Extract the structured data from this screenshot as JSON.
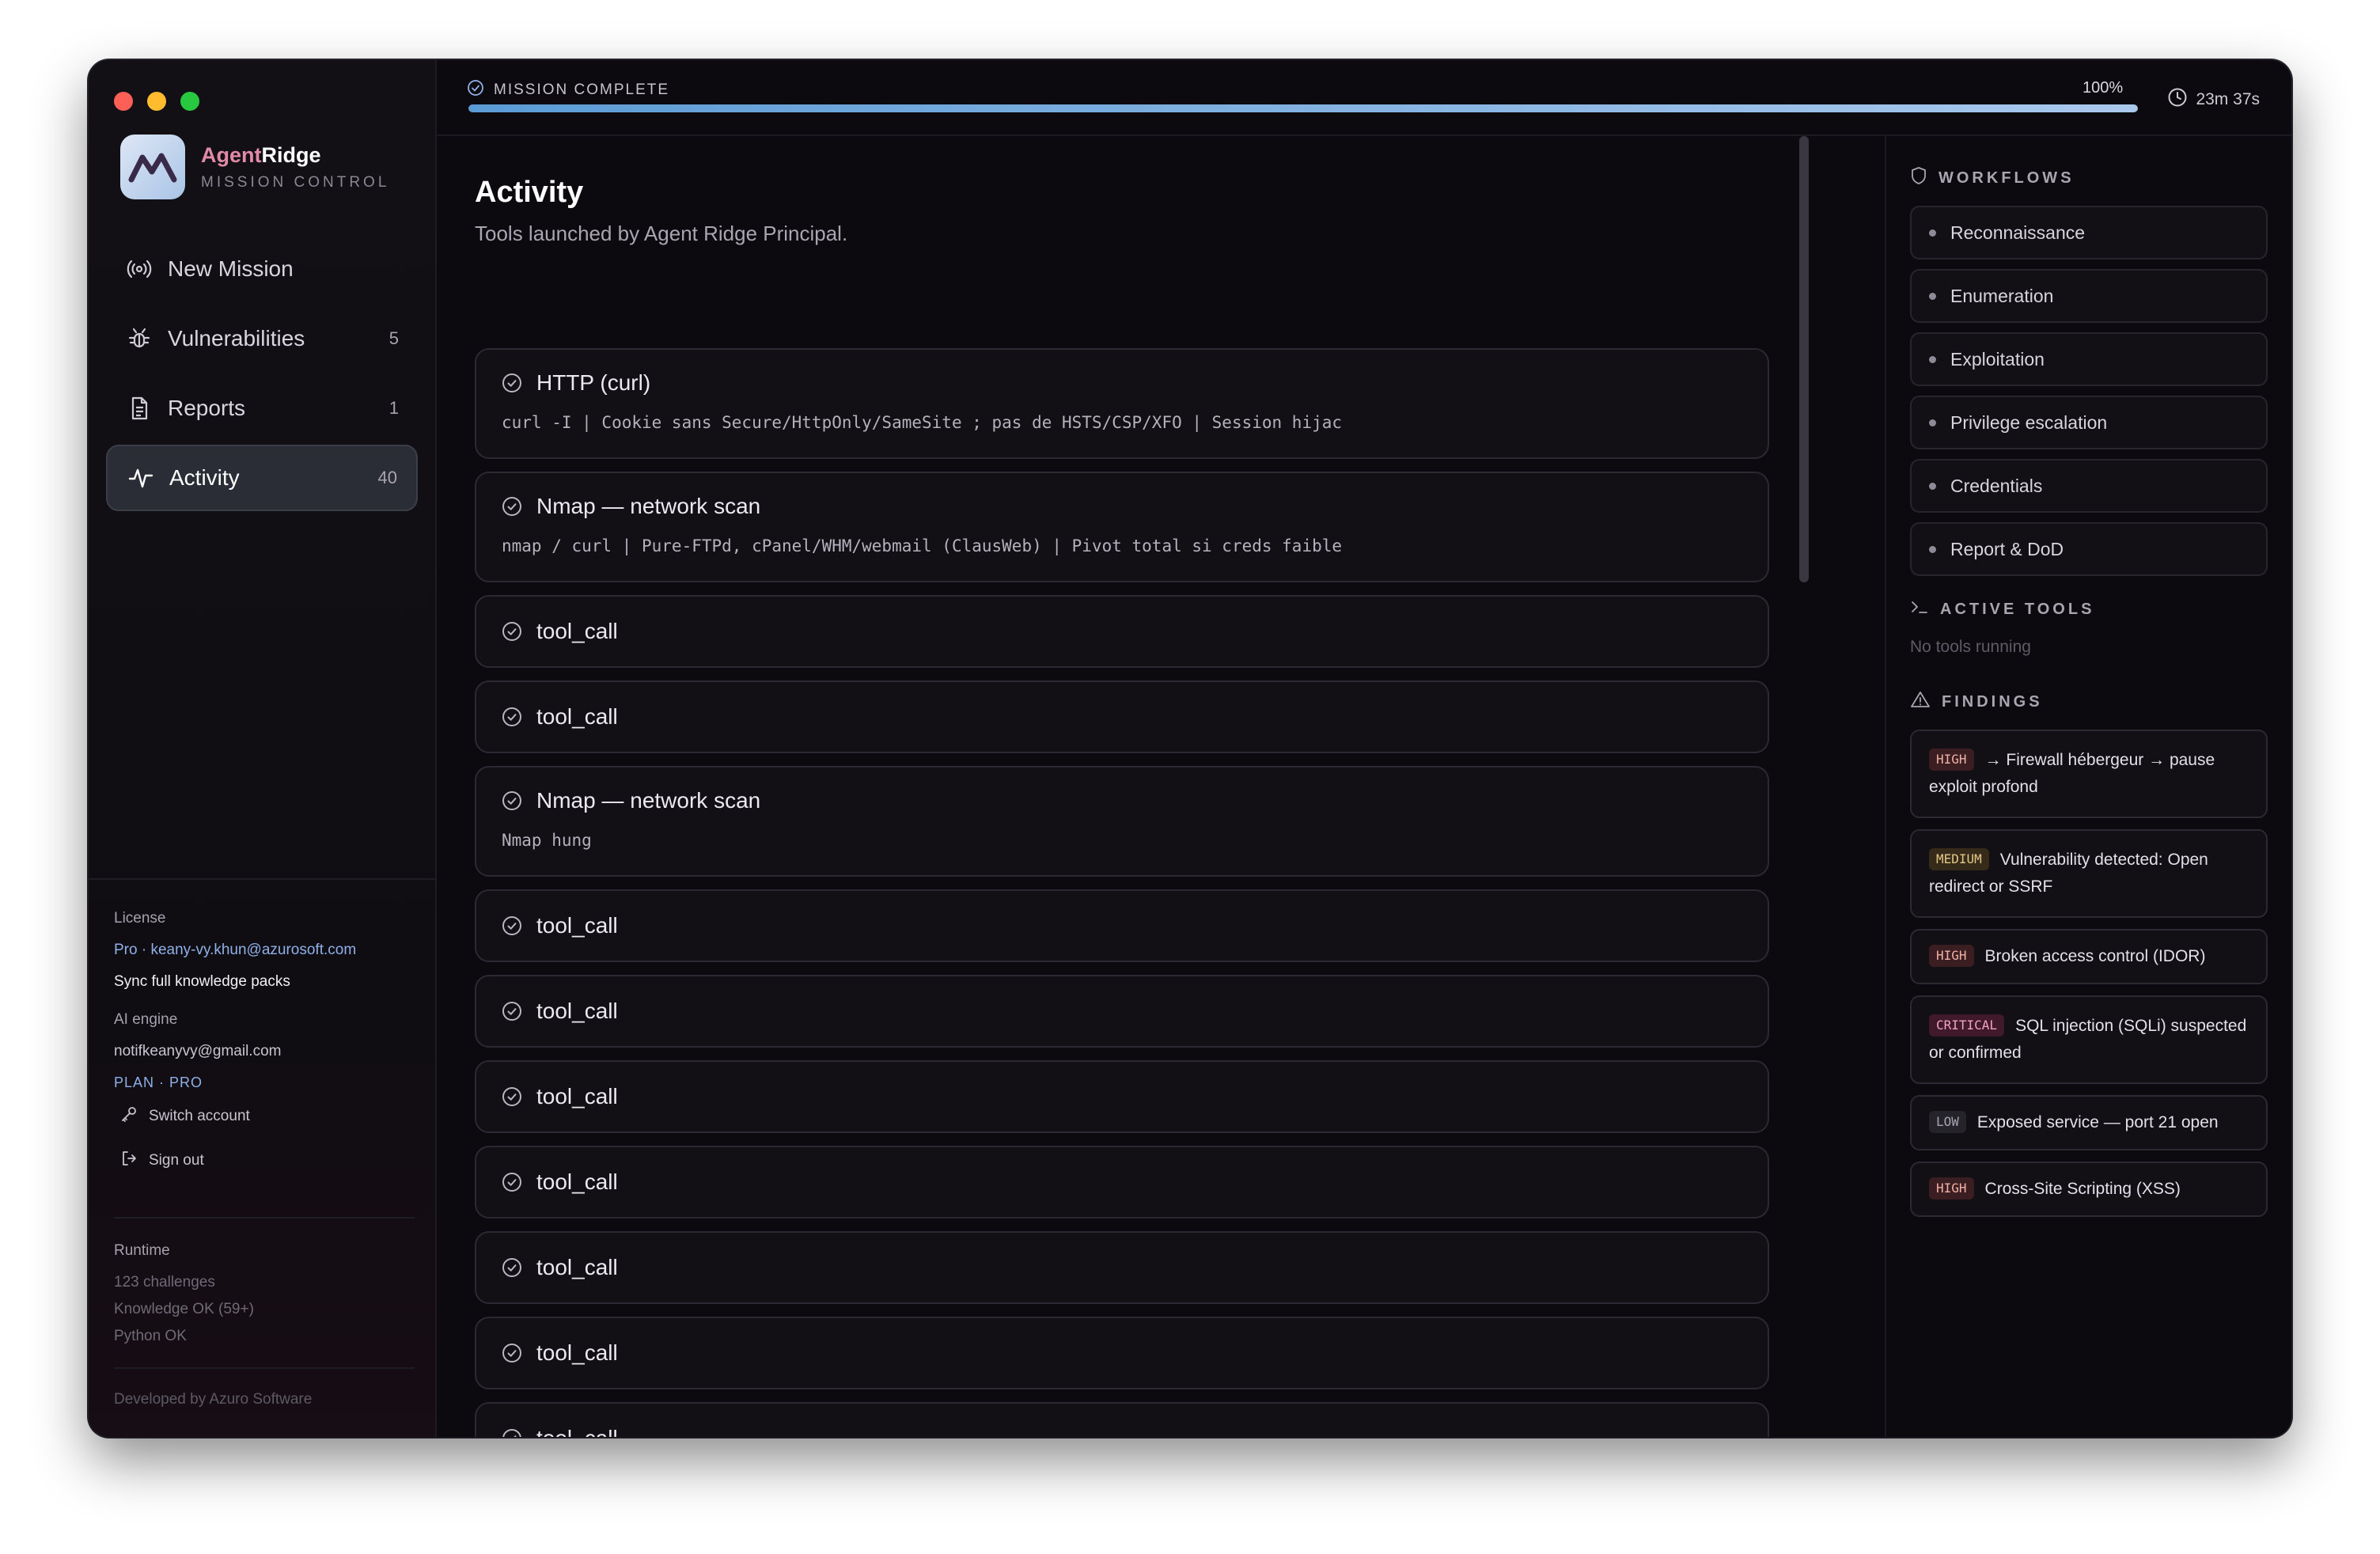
{
  "app": {
    "brand_part1": "Agent",
    "brand_part2": "Ridge",
    "subtitle": "MISSION CONTROL"
  },
  "nav": {
    "items": [
      {
        "label": "New Mission",
        "icon": "broadcast-icon",
        "count": ""
      },
      {
        "label": "Vulnerabilities",
        "icon": "bug-icon",
        "count": "5"
      },
      {
        "label": "Reports",
        "icon": "document-icon",
        "count": "1"
      },
      {
        "label": "Activity",
        "icon": "activity-pulse-icon",
        "count": "40",
        "active": true
      }
    ]
  },
  "license": {
    "label": "License",
    "plan_email": "Pro · keany-vy.khun@azurosoft.com",
    "sync_link": "Sync full knowledge packs"
  },
  "ai_engine": {
    "label": "AI engine",
    "email": "notifkeanyvy@gmail.com",
    "plan": "PLAN · PRO",
    "switch_account": "Switch account",
    "sign_out": "Sign out"
  },
  "runtime": {
    "label": "Runtime",
    "lines": [
      "123 challenges",
      "Knowledge OK (59+)",
      "Python OK"
    ]
  },
  "footer": "Developed by Azuro Software",
  "topbar": {
    "status": "MISSION COMPLETE",
    "progress_percent": 100,
    "progress_label": "100%",
    "timer": "23m 37s"
  },
  "main": {
    "title": "Activity",
    "subtitle": "Tools launched by Agent Ridge Principal.",
    "activities": [
      {
        "title": "HTTP (curl)",
        "detail": "curl -I | Cookie sans Secure/HttpOnly/SameSite ; pas de HSTS/CSP/XFO | Session hijac"
      },
      {
        "title": "Nmap — network scan",
        "detail": "nmap / curl | Pure-FTPd, cPanel/WHM/webmail (ClausWeb) | Pivot total si creds faible"
      },
      {
        "title": "tool_call",
        "detail": ""
      },
      {
        "title": "tool_call",
        "detail": ""
      },
      {
        "title": "Nmap — network scan",
        "detail": "Nmap hung"
      },
      {
        "title": "tool_call",
        "detail": ""
      },
      {
        "title": "tool_call",
        "detail": ""
      },
      {
        "title": "tool_call",
        "detail": ""
      },
      {
        "title": "tool_call",
        "detail": ""
      },
      {
        "title": "tool_call",
        "detail": ""
      },
      {
        "title": "tool_call",
        "detail": ""
      },
      {
        "title": "tool_call",
        "detail": ""
      }
    ]
  },
  "right_panel": {
    "workflows_title": "WORKFLOWS",
    "workflows": [
      "Reconnaissance",
      "Enumeration",
      "Exploitation",
      "Privilege escalation",
      "Credentials",
      "Report & DoD"
    ],
    "active_tools_title": "ACTIVE TOOLS",
    "active_tools_empty": "No tools running",
    "findings_title": "FINDINGS",
    "findings": [
      {
        "severity": "HIGH",
        "text": "→ Firewall hébergeur → pause exploit profond"
      },
      {
        "severity": "MEDIUM",
        "text": "Vulnerability detected: Open redirect or SSRF"
      },
      {
        "severity": "HIGH",
        "text": "Broken access control (IDOR)"
      },
      {
        "severity": "CRITICAL",
        "text": "SQL injection (SQLi) suspected or confirmed"
      },
      {
        "severity": "LOW",
        "text": "Exposed service — port 21 open"
      },
      {
        "severity": "HIGH",
        "text": "Cross-Site Scripting (XSS)"
      }
    ]
  },
  "colors": {
    "window_bg": "#0c0a0e",
    "accent_blue": "#5b9bd5",
    "brand_pink": "#e28aa6",
    "high": "#f0b0a4",
    "medium": "#e5c78a",
    "critical": "#f2a2c0",
    "low": "#a6a2ae"
  }
}
